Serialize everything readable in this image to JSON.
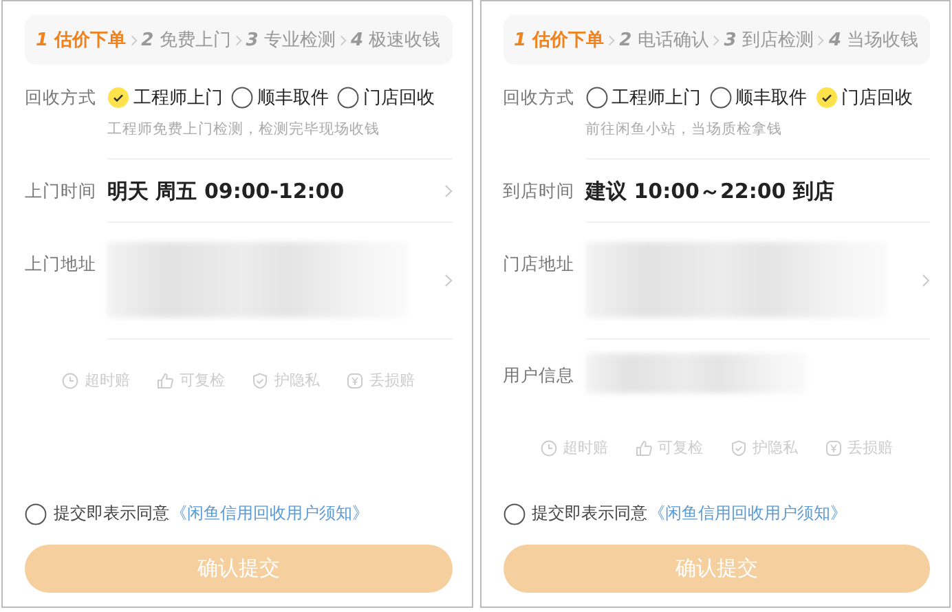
{
  "panels": [
    {
      "steps": [
        {
          "number": "1",
          "label": "估价下单",
          "selected": true
        },
        {
          "number": "2",
          "label": "免费上门",
          "selected": false
        },
        {
          "number": "3",
          "label": "专业检测",
          "selected": false
        },
        {
          "number": "4",
          "label": "极速收钱",
          "selected": false
        }
      ],
      "method": {
        "label": "回收方式",
        "options": [
          {
            "label": "工程师上门",
            "checked": true
          },
          {
            "label": "顺丰取件",
            "checked": false
          },
          {
            "label": "门店回收",
            "checked": false
          }
        ],
        "hint": "工程师免费上门检测，检测完毕现场收钱"
      },
      "rows": [
        {
          "kind": "text",
          "label": "上门时间",
          "value": "明天  周五 09:00-12:00",
          "chevron": true,
          "divider": true
        },
        {
          "kind": "blurblock",
          "label": "上门地址",
          "chevron": true,
          "divider": true
        }
      ],
      "guarantees": [
        {
          "kind": "clock",
          "label": "超时赔"
        },
        {
          "kind": "thumb",
          "label": "可复检"
        },
        {
          "kind": "shield",
          "label": "护隐私"
        },
        {
          "kind": "yen",
          "label": "丢损赔"
        }
      ],
      "agreement": {
        "checked": false,
        "text": "提交即表示同意",
        "link": "《闲鱼信用回收用户须知》"
      },
      "button": "确认提交"
    },
    {
      "steps": [
        {
          "number": "1",
          "label": "估价下单",
          "selected": true
        },
        {
          "number": "2",
          "label": "电话确认",
          "selected": false
        },
        {
          "number": "3",
          "label": "到店检测",
          "selected": false
        },
        {
          "number": "4",
          "label": "当场收钱",
          "selected": false
        }
      ],
      "method": {
        "label": "回收方式",
        "options": [
          {
            "label": "工程师上门",
            "checked": false
          },
          {
            "label": "顺丰取件",
            "checked": false
          },
          {
            "label": "门店回收",
            "checked": true
          }
        ],
        "hint": "前往闲鱼小站，当场质检拿钱"
      },
      "rows": [
        {
          "kind": "text",
          "label": "到店时间",
          "value": "建议 10:00～22:00 到店",
          "chevron": false,
          "divider": true
        },
        {
          "kind": "blurblock",
          "label": "门店地址",
          "chevron": true,
          "divider": true
        },
        {
          "kind": "blurline",
          "label": "用户信息",
          "chevron": false,
          "divider": false
        }
      ],
      "guarantees": [
        {
          "kind": "clock",
          "label": "超时赔"
        },
        {
          "kind": "thumb",
          "label": "可复检"
        },
        {
          "kind": "shield",
          "label": "护隐私"
        },
        {
          "kind": "yen",
          "label": "丢损赔"
        }
      ],
      "agreement": {
        "checked": false,
        "text": "提交即表示同意",
        "link": "《闲鱼信用回收用户须知》"
      },
      "button": "确认提交"
    }
  ]
}
